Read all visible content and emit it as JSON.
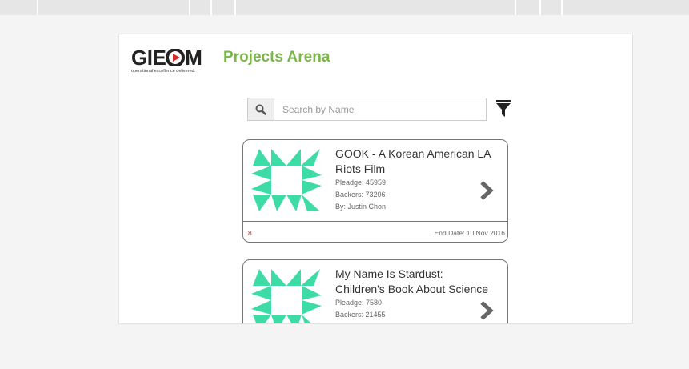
{
  "app": {
    "logo_text": "GIEOM",
    "logo_tagline": "operational excellence delivered.",
    "title": "Projects Arena"
  },
  "search": {
    "placeholder": "Search by Name",
    "value": ""
  },
  "projects": [
    {
      "name": "GOOK - A Korean American LA Riots Film",
      "pledge": "Pleadge: 45959",
      "backers": "Backers: 73206",
      "by": "By: Justin Chon",
      "count": "8",
      "end_date": "End Date: 10 Nov 2016"
    },
    {
      "name": "My Name Is Stardust: Children's Book About Science",
      "pledge": "Pleadge: 7580",
      "backers": "Backers: 21455",
      "by": "",
      "count": "",
      "end_date": ""
    }
  ],
  "colors": {
    "title_green": "#7ab648",
    "thumb_teal": "#3ddca6",
    "count_red": "#c0392b",
    "logo_red": "#d62b2b"
  }
}
